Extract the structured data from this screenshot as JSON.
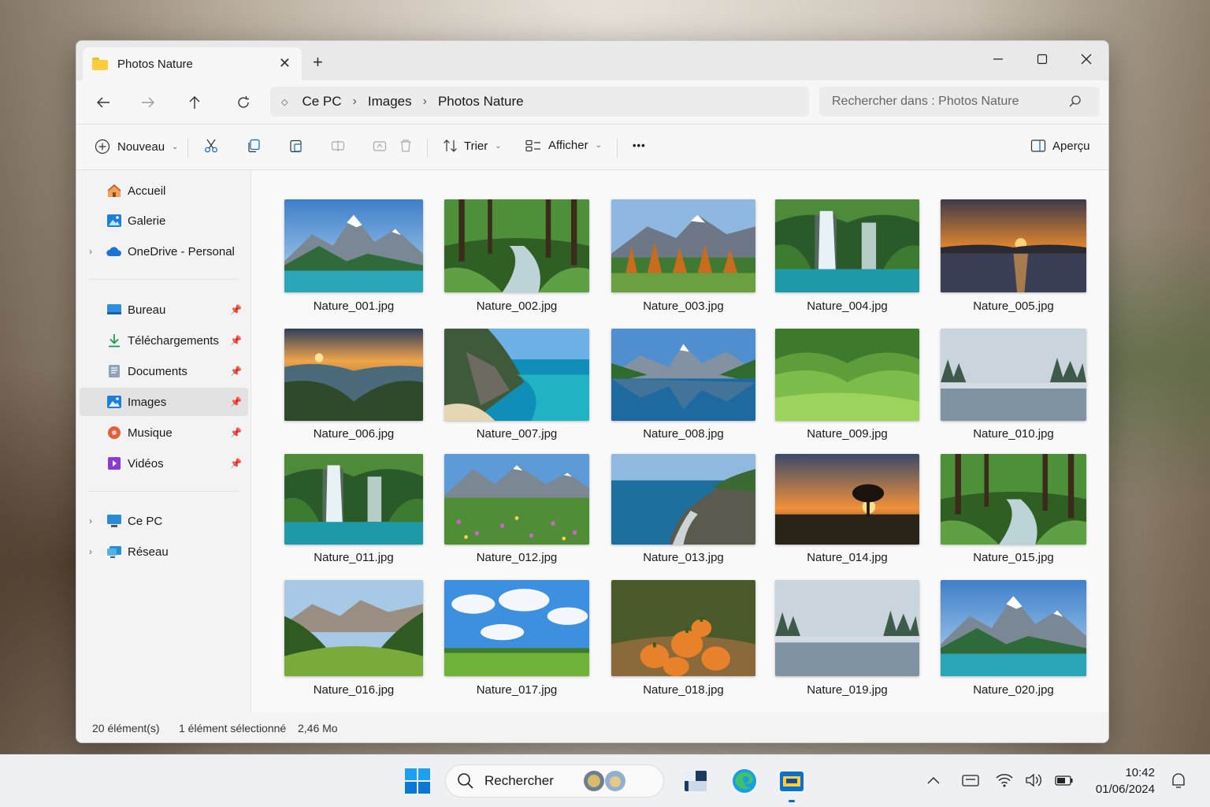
{
  "window": {
    "tab_title": "Photos Nature",
    "minimize_label": "—",
    "maximize_label": "☐",
    "close_label": "✕"
  },
  "nav": {
    "breadcrumb": [
      "Ce PC",
      "Images",
      "Photos Nature"
    ],
    "search_placeholder": "Rechercher dans : Photos Nature"
  },
  "toolbar": {
    "new_label": "Nouveau",
    "sort_label": "Trier",
    "view_label": "Afficher",
    "more_label": "•••",
    "preview_label": "Aperçu"
  },
  "sidebar": {
    "items": [
      {
        "label": "Accueil",
        "icon": "home-icon"
      },
      {
        "label": "Galerie",
        "icon": "gallery-icon"
      },
      {
        "label": "OneDrive - Personal",
        "icon": "cloud-icon"
      },
      {
        "label": "Bureau",
        "icon": "desktop-icon"
      },
      {
        "label": "Téléchargements",
        "icon": "download-icon"
      },
      {
        "label": "Documents",
        "icon": "documents-icon"
      },
      {
        "label": "Images",
        "icon": "pictures-icon"
      },
      {
        "label": "Musique",
        "icon": "music-icon"
      },
      {
        "label": "Vidéos",
        "icon": "videos-icon"
      },
      {
        "label": "Ce PC",
        "icon": "pc-icon"
      },
      {
        "label": "Réseau",
        "icon": "network-icon"
      }
    ],
    "selected": "Images"
  },
  "files": [
    {
      "name": "Nature_001.jpg",
      "scene": "mountain-lake"
    },
    {
      "name": "Nature_002.jpg",
      "scene": "forest-stream"
    },
    {
      "name": "Nature_003.jpg",
      "scene": "autumn-mountains"
    },
    {
      "name": "Nature_004.jpg",
      "scene": "waterfall"
    },
    {
      "name": "Nature_005.jpg",
      "scene": "lake-sunset"
    },
    {
      "name": "Nature_006.jpg",
      "scene": "valley-sunset"
    },
    {
      "name": "Nature_007.jpg",
      "scene": "coastal-cove"
    },
    {
      "name": "Nature_008.jpg",
      "scene": "mountain-reflection"
    },
    {
      "name": "Nature_009.jpg",
      "scene": "green-hills"
    },
    {
      "name": "Nature_010.jpg",
      "scene": "misty-lake"
    },
    {
      "name": "Nature_011.jpg",
      "scene": "waterfall"
    },
    {
      "name": "Nature_012.jpg",
      "scene": "flower-meadow"
    },
    {
      "name": "Nature_013.jpg",
      "scene": "rocky-coast"
    },
    {
      "name": "Nature_014.jpg",
      "scene": "tree-sunset"
    },
    {
      "name": "Nature_015.jpg",
      "scene": "forest-stream"
    },
    {
      "name": "Nature_016.jpg",
      "scene": "alpine-valley"
    },
    {
      "name": "Nature_017.jpg",
      "scene": "sky-field"
    },
    {
      "name": "Nature_018.jpg",
      "scene": "pumpkins"
    },
    {
      "name": "Nature_019.jpg",
      "scene": "misty-lake"
    },
    {
      "name": "Nature_020.jpg",
      "scene": "mountain-lake"
    }
  ],
  "status": {
    "count": "20 élément(s)",
    "selection": "1 élément sélectionné",
    "size": "2,46 Mo"
  },
  "taskbar": {
    "search_label": "Rechercher",
    "apps": [
      "start-icon",
      "explorer-widget-icon",
      "edge-icon",
      "file-explorer-icon"
    ],
    "time": "10:42",
    "date": "01/06/2024"
  },
  "colors": {
    "selection_bg": "#e2e2e2",
    "accent": "#0a67c2",
    "folder": "#ffcd3c"
  }
}
